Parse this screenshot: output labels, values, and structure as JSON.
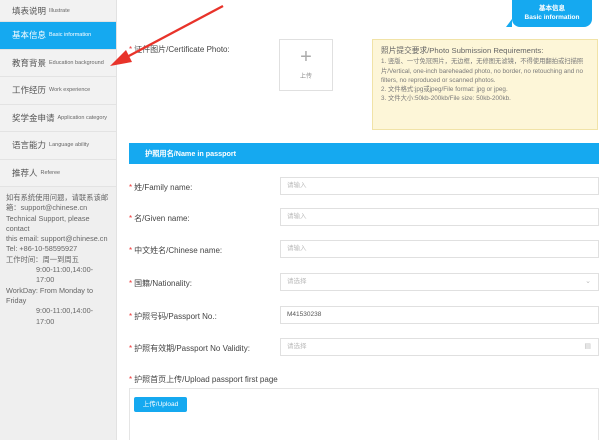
{
  "sidebar": {
    "items": [
      {
        "cn": "填表说明",
        "en": "Illustrate"
      },
      {
        "cn": "基本信息",
        "en": "Basic information"
      },
      {
        "cn": "教育背景",
        "en": "Education background"
      },
      {
        "cn": "工作经历",
        "en": "Work experience"
      },
      {
        "cn": "奖学金申请",
        "en": "Application category"
      },
      {
        "cn": "语言能力",
        "en": "Language ability"
      },
      {
        "cn": "推荐人",
        "en": "Referee"
      }
    ],
    "active_index": 1,
    "support_lines": [
      "如有系统使用问题，请联系该邮",
      "箱：support@chinese.cn",
      "Technical Support, please contact",
      "this email: support@chinese.cn",
      "Tel: +86-10-58595927",
      "工作时间：周一到周五",
      "9:00-11:00,14:00-17:00",
      "WorkDay: From Monday to Friday",
      "9:00-11:00,14:00-17:00"
    ]
  },
  "badge": {
    "line1": "基本信息",
    "line2": "Basic information"
  },
  "photo": {
    "label": "证件图片/Certificate Photo:",
    "upload_label": "上传",
    "req_title": "照片提交要求/Photo Submission Requirements:",
    "req_lines": [
      "1. 竖版、一寸免冠照片，无边框，无修图无滤镜，不得使用翻拍或扫描照片/Vertical, one-inch bareheaded photo, no border, no retouching and no filters, no reproduced or scanned photos.",
      "2. 文件格式:jpg或jpeg/File format: jpg or jpeg.",
      "3. 文件大小:50kb-200kb/File size: 50kb-200kb."
    ]
  },
  "section": {
    "title": "护照用名/Name in passport"
  },
  "fields": [
    {
      "label": "姓/Family name:",
      "value": "请输入",
      "filled": false,
      "icon": ""
    },
    {
      "label": "名/Given name:",
      "value": "请输入",
      "filled": false,
      "icon": ""
    },
    {
      "label": "中文姓名/Chinese name:",
      "value": "请输入",
      "filled": false,
      "icon": ""
    },
    {
      "label": "国籍/Nationality:",
      "value": "请选择",
      "filled": false,
      "icon": "chevron-down-icon"
    },
    {
      "label": "护照号码/Passport No.:",
      "value": "M41530238",
      "filled": true,
      "icon": ""
    },
    {
      "label": "护照有效期/Passport No Validity:",
      "value": "请选择",
      "filled": false,
      "icon": "calendar-icon"
    }
  ],
  "passport_upload": {
    "label": "护照首页上传/Upload passport first page",
    "button": "上传/Upload"
  },
  "colors": {
    "accent": "#15a9f0",
    "annotation": "#e8332a"
  }
}
